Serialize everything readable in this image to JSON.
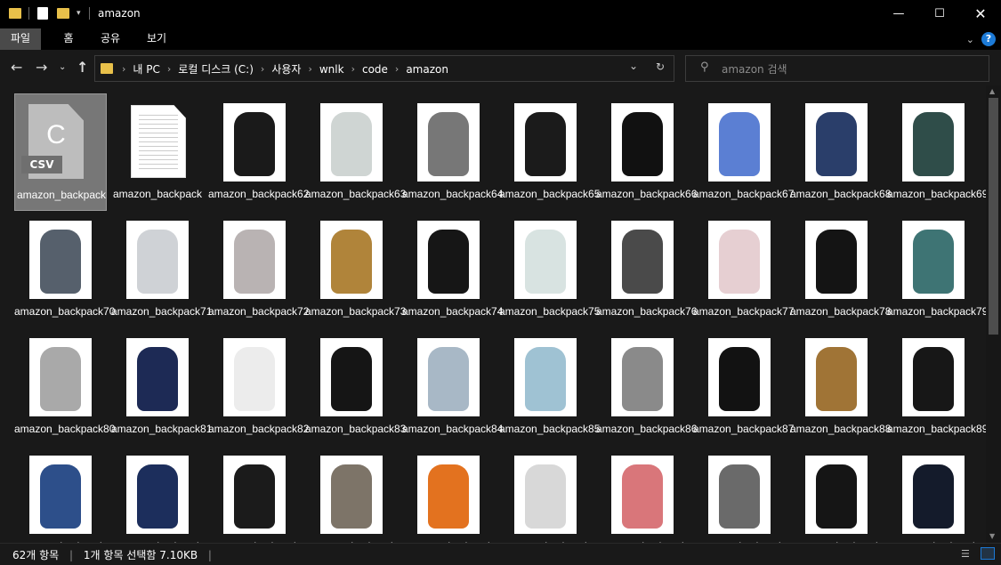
{
  "window": {
    "title": "amazon"
  },
  "ribbon": {
    "tabs": [
      "파일",
      "홈",
      "공유",
      "보기"
    ],
    "help": "?"
  },
  "address": {
    "crumbs": [
      "내 PC",
      "로컬 디스크 (C:)",
      "사용자",
      "wnlk",
      "code",
      "amazon"
    ]
  },
  "search": {
    "placeholder": "amazon 검색"
  },
  "files": [
    {
      "name": "amazon_backpack",
      "kind": "csv",
      "selected": true
    },
    {
      "name": "amazon_backpack",
      "kind": "doc"
    },
    {
      "name": "amazon_backpack62",
      "kind": "img",
      "color": "#1a1a1a"
    },
    {
      "name": "amazon_backpack63",
      "kind": "img",
      "color": "#cfd5d3"
    },
    {
      "name": "amazon_backpack64",
      "kind": "img",
      "color": "#777777"
    },
    {
      "name": "amazon_backpack65",
      "kind": "img",
      "color": "#1b1b1b"
    },
    {
      "name": "amazon_backpack66",
      "kind": "img",
      "color": "#111111"
    },
    {
      "name": "amazon_backpack67",
      "kind": "img",
      "color": "#5b7fd3"
    },
    {
      "name": "amazon_backpack68",
      "kind": "img",
      "color": "#2a3e6a"
    },
    {
      "name": "amazon_backpack69",
      "kind": "img",
      "color": "#2f4d49"
    },
    {
      "name": "amazon_backpack70",
      "kind": "img",
      "color": "#56606c"
    },
    {
      "name": "amazon_backpack71",
      "kind": "img",
      "color": "#cfd2d6"
    },
    {
      "name": "amazon_backpack72",
      "kind": "img",
      "color": "#b9b3b3"
    },
    {
      "name": "amazon_backpack73",
      "kind": "img",
      "color": "#b0843a"
    },
    {
      "name": "amazon_backpack74",
      "kind": "img",
      "color": "#161616"
    },
    {
      "name": "amazon_backpack75",
      "kind": "img",
      "color": "#d8e3e1"
    },
    {
      "name": "amazon_backpack76",
      "kind": "img",
      "color": "#4a4a4a"
    },
    {
      "name": "amazon_backpack77",
      "kind": "img",
      "color": "#e6cfd2"
    },
    {
      "name": "amazon_backpack78",
      "kind": "img",
      "color": "#141414"
    },
    {
      "name": "amazon_backpack79",
      "kind": "img",
      "color": "#3e7474"
    },
    {
      "name": "amazon_backpack80",
      "kind": "img",
      "color": "#a9a9a9"
    },
    {
      "name": "amazon_backpack81",
      "kind": "img",
      "color": "#1d2a55"
    },
    {
      "name": "amazon_backpack82",
      "kind": "img",
      "color": "#ececec"
    },
    {
      "name": "amazon_backpack83",
      "kind": "img",
      "color": "#151515"
    },
    {
      "name": "amazon_backpack84",
      "kind": "img",
      "color": "#a8b8c6"
    },
    {
      "name": "amazon_backpack85",
      "kind": "img",
      "color": "#9fc2d3"
    },
    {
      "name": "amazon_backpack86",
      "kind": "img",
      "color": "#8a8a8a"
    },
    {
      "name": "amazon_backpack87",
      "kind": "img",
      "color": "#121212"
    },
    {
      "name": "amazon_backpack88",
      "kind": "img",
      "color": "#a07436"
    },
    {
      "name": "amazon_backpack89",
      "kind": "img",
      "color": "#171717"
    },
    {
      "name": "amazon_backpack",
      "kind": "img",
      "color": "#2d4f8a"
    },
    {
      "name": "amazon_backpack",
      "kind": "img",
      "color": "#1c2e5c"
    },
    {
      "name": "amazon_backpack",
      "kind": "img",
      "color": "#1b1b1b"
    },
    {
      "name": "amazon_backpack",
      "kind": "img",
      "color": "#7d7468"
    },
    {
      "name": "amazon_backpack",
      "kind": "img",
      "color": "#e3721f"
    },
    {
      "name": "amazon_backpack",
      "kind": "img",
      "color": "#d8d8d8"
    },
    {
      "name": "amazon_backpack",
      "kind": "img",
      "color": "#d9767a"
    },
    {
      "name": "amazon_backpack",
      "kind": "img",
      "color": "#6a6a6a"
    },
    {
      "name": "amazon_backpack",
      "kind": "img",
      "color": "#151515"
    },
    {
      "name": "amazon_backpack",
      "kind": "img",
      "color": "#141b2b"
    }
  ],
  "csv_badge": "CSV",
  "csv_letter": "C",
  "status": {
    "count": "62개 항목",
    "selection": "1개 항목 선택함 7.10KB"
  },
  "colors": {
    "background": "#191919",
    "folder": "#e8c04a",
    "accent": "#1c7ad6"
  }
}
